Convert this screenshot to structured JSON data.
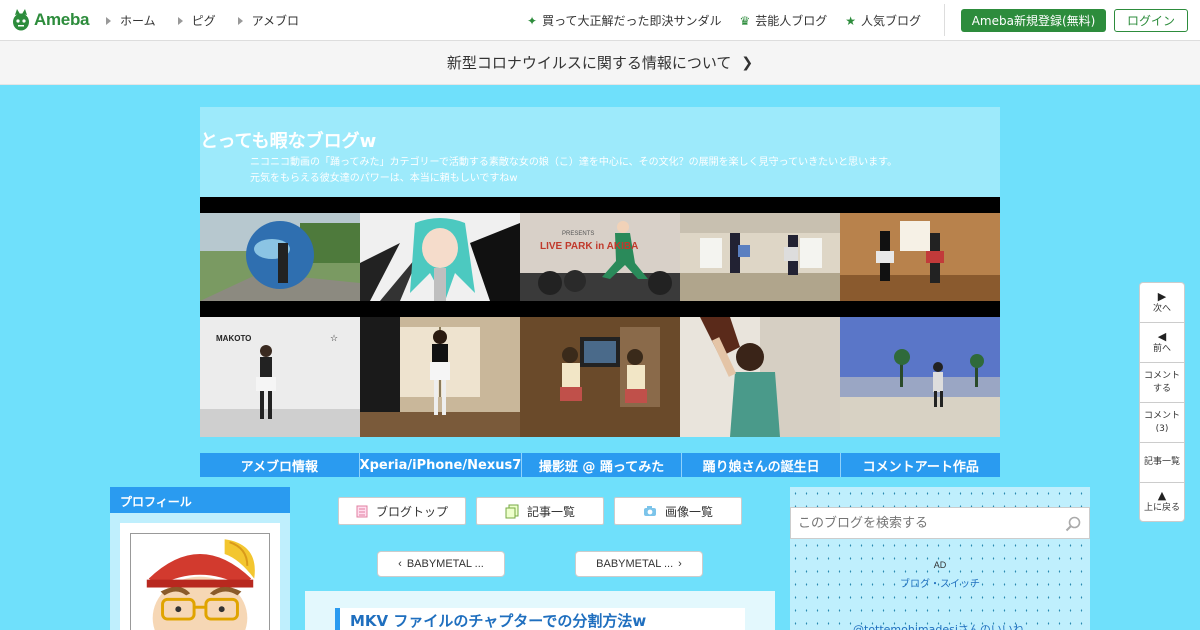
{
  "topbar": {
    "logo_text": "Ameba",
    "nav": [
      {
        "label": "ホーム"
      },
      {
        "label": "ピグ"
      },
      {
        "label": "アメブロ"
      }
    ],
    "links": [
      {
        "label": "買って大正解だった即決サンダル",
        "icon": "sparkle-icon"
      },
      {
        "label": "芸能人ブログ",
        "icon": "crown-icon"
      },
      {
        "label": "人気ブログ",
        "icon": "star-icon"
      }
    ],
    "register_label": "Ameba新規登録(無料)",
    "login_label": "ログイン"
  },
  "notice": {
    "text": "新型コロナウイルスに関する情報について"
  },
  "blog": {
    "title": "とっても暇なブログw",
    "desc_line1": "ニコニコ動画の「踊ってみた」カテゴリーで活動する素敵な女の娘（こ）達を中心に、その文化？の展開を楽しく見守っていきたいと思います。",
    "desc_line2": "元気をもらえる彼女達のパワーは、本当に頼もしいですねw"
  },
  "gallery": {
    "caption_makoto": "MAKOTO",
    "caption_star": "☆",
    "caption_live": "LIVE PARK in AKIBA",
    "caption_presents": "PRESENTS"
  },
  "categories": [
    {
      "label": "アメブロ情報"
    },
    {
      "label": "Xperia/iPhone/Nexus7"
    },
    {
      "label": "撮影班 @ 踊ってみた"
    },
    {
      "label": "踊り娘さんの誕生日"
    },
    {
      "label": "コメントアート作品"
    }
  ],
  "profile": {
    "heading": "プロフィール"
  },
  "center": {
    "blog_top": "ブログトップ",
    "entries": "記事一覧",
    "images": "画像一覧",
    "prev_entry": "BABYMETAL ...",
    "next_entry": "BABYMETAL ...",
    "article_title": "MKV ファイルのチャプターでの分割方法w"
  },
  "right": {
    "search_placeholder": "このブログを検索する",
    "ad_label": "AD",
    "ad_link": "ブログ・スイッチ",
    "iiwa": "@tottemohimadesiさんのいいね"
  },
  "floatnav": [
    {
      "arrow": "▶",
      "label": "次へ"
    },
    {
      "arrow": "◀",
      "label": "前へ"
    },
    {
      "arrow": "",
      "label": "コメント\nする"
    },
    {
      "arrow": "",
      "label": "コメント\n(3)"
    },
    {
      "arrow": "",
      "label": "記事一覧"
    },
    {
      "arrow": "▲",
      "label": "上に戻る"
    }
  ],
  "colors": {
    "brand_green": "#2d8c3c",
    "page_bg": "#6fe0fb",
    "accent_blue": "#2a9bf0"
  }
}
